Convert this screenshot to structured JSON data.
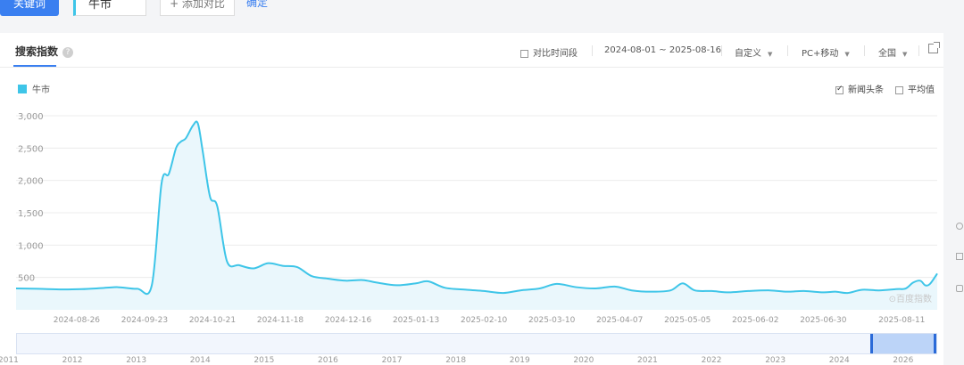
{
  "toolbar": {
    "keyword_button": "关键词",
    "keyword": "牛市",
    "add_compare": "+ 添加对比",
    "confirm": "确定"
  },
  "panel": {
    "title": "搜索指数",
    "help_glyph": "?",
    "compare_period_label": "对比时间段",
    "date_range": "2024-08-01 ~ 2025-08-16",
    "custom_label": "自定义",
    "device_label": "PC+移动",
    "region_label": "全国",
    "news_headlines_label": "新闻头条",
    "news_headlines_checked": true,
    "average_label": "平均值",
    "average_checked": false,
    "watermark": "⊙百度指数"
  },
  "colors": {
    "accent": "#3a7ff0",
    "series": "#3ec5e8",
    "fill": "#eaf7fc"
  },
  "icons": {
    "export": "external-link-icon",
    "help": "question-icon"
  },
  "chart_data": {
    "type": "area",
    "series": [
      {
        "name": "牛市",
        "points": [
          [
            "2024-08-01",
            330
          ],
          [
            "2024-08-10",
            325
          ],
          [
            "2024-08-20",
            315
          ],
          [
            "2024-08-28",
            320
          ],
          [
            "2024-09-05",
            335
          ],
          [
            "2024-09-12",
            350
          ],
          [
            "2024-09-20",
            325
          ],
          [
            "2024-09-26",
            380
          ],
          [
            "2024-09-30",
            1950
          ],
          [
            "2024-10-03",
            2100
          ],
          [
            "2024-10-06",
            2500
          ],
          [
            "2024-10-08",
            2600
          ],
          [
            "2024-10-10",
            2650
          ],
          [
            "2024-10-13",
            2850
          ],
          [
            "2024-10-15",
            2880
          ],
          [
            "2024-10-17",
            2450
          ],
          [
            "2024-10-20",
            1750
          ],
          [
            "2024-10-23",
            1600
          ],
          [
            "2024-10-27",
            750
          ],
          [
            "2024-11-01",
            690
          ],
          [
            "2024-11-07",
            640
          ],
          [
            "2024-11-13",
            720
          ],
          [
            "2024-11-19",
            680
          ],
          [
            "2024-11-25",
            660
          ],
          [
            "2024-12-01",
            520
          ],
          [
            "2024-12-08",
            480
          ],
          [
            "2024-12-15",
            450
          ],
          [
            "2024-12-22",
            460
          ],
          [
            "2024-12-28",
            420
          ],
          [
            "2025-01-05",
            380
          ],
          [
            "2025-01-13",
            410
          ],
          [
            "2025-01-18",
            440
          ],
          [
            "2025-01-25",
            340
          ],
          [
            "2025-02-03",
            310
          ],
          [
            "2025-02-10",
            290
          ],
          [
            "2025-02-18",
            260
          ],
          [
            "2025-02-25",
            300
          ],
          [
            "2025-03-05",
            330
          ],
          [
            "2025-03-12",
            400
          ],
          [
            "2025-03-20",
            350
          ],
          [
            "2025-03-28",
            330
          ],
          [
            "2025-04-05",
            360
          ],
          [
            "2025-04-12",
            300
          ],
          [
            "2025-04-20",
            280
          ],
          [
            "2025-04-28",
            300
          ],
          [
            "2025-05-03",
            410
          ],
          [
            "2025-05-08",
            300
          ],
          [
            "2025-05-15",
            290
          ],
          [
            "2025-05-22",
            270
          ],
          [
            "2025-05-30",
            290
          ],
          [
            "2025-06-08",
            300
          ],
          [
            "2025-06-15",
            280
          ],
          [
            "2025-06-22",
            290
          ],
          [
            "2025-06-30",
            270
          ],
          [
            "2025-07-05",
            280
          ],
          [
            "2025-07-10",
            260
          ],
          [
            "2025-07-16",
            310
          ],
          [
            "2025-07-23",
            300
          ],
          [
            "2025-07-30",
            320
          ],
          [
            "2025-08-03",
            330
          ],
          [
            "2025-08-06",
            420
          ],
          [
            "2025-08-09",
            450
          ],
          [
            "2025-08-11",
            380
          ],
          [
            "2025-08-13",
            400
          ],
          [
            "2025-08-16",
            560
          ]
        ]
      }
    ],
    "ylim": [
      0,
      3000
    ],
    "y_ticks": [
      3000,
      2500,
      2000,
      1500,
      1000,
      500
    ],
    "y_tick_labels": [
      "3,000",
      "2,500",
      "2,000",
      "1,500",
      "1,000",
      "500"
    ],
    "x_range": [
      "2024-08-01",
      "2025-08-16"
    ],
    "x_ticks": [
      "2024-08-26",
      "2024-09-23",
      "2024-10-21",
      "2024-11-18",
      "2024-12-16",
      "2025-01-13",
      "2025-02-10",
      "2025-03-10",
      "2025-04-07",
      "2025-05-05",
      "2025-06-02",
      "2025-06-30",
      "2025-08-11"
    ],
    "x_tick_labels": [
      "2024-08-26",
      "2024-09-23",
      "2024-10-21",
      "2024-11-18",
      "2024-12-16",
      "2025-01-13",
      "2025-02-10",
      "2025-03-10",
      "2025-04-07",
      "2025-05-05",
      "2025-06-02",
      "2025-06-30",
      "2025-08-11"
    ],
    "grid": true,
    "legend": "top-left"
  },
  "navigator": {
    "years": [
      "2011",
      "2012",
      "2013",
      "2014",
      "2015",
      "2016",
      "2017",
      "2018",
      "2019",
      "2020",
      "2021",
      "2022",
      "2023",
      "2024",
      "2026"
    ],
    "selected_from": "2024-08-01",
    "selected_to": "2025-08-16"
  }
}
